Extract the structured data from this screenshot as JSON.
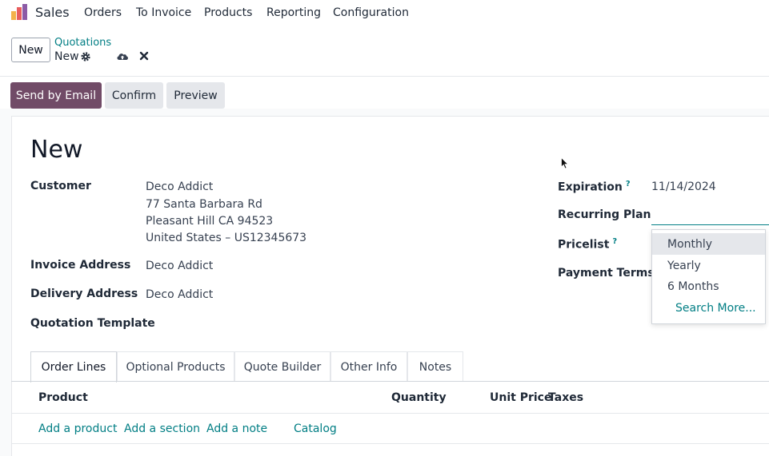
{
  "nav": {
    "app": "Sales",
    "items": [
      "Orders",
      "To Invoice",
      "Products",
      "Reporting",
      "Configuration"
    ]
  },
  "control": {
    "new_label": "New",
    "breadcrumb": "Quotations",
    "record": "New"
  },
  "actions": {
    "send": "Send by Email",
    "confirm": "Confirm",
    "preview": "Preview"
  },
  "form": {
    "title": "New",
    "customer_label": "Customer",
    "customer_lines": [
      "Deco Addict",
      "77 Santa Barbara Rd",
      "Pleasant Hill CA 94523",
      "United States – US12345673"
    ],
    "invoice_label": "Invoice Address",
    "invoice_value": "Deco Addict",
    "delivery_label": "Delivery Address",
    "delivery_value": "Deco Addict",
    "template_label": "Quotation Template",
    "expiration_label": "Expiration",
    "expiration_value": "11/14/2024",
    "recurring_label": "Recurring Plan",
    "pricelist_label": "Pricelist",
    "payment_label": "Payment Terms",
    "help_mark": "?"
  },
  "dropdown": {
    "options": [
      "Monthly",
      "Yearly",
      "6 Months"
    ],
    "more": "Search More..."
  },
  "tabs": [
    "Order Lines",
    "Optional Products",
    "Quote Builder",
    "Other Info",
    "Notes"
  ],
  "lines": {
    "columns": [
      "Product",
      "Quantity",
      "Unit Price",
      "Taxes"
    ],
    "links": [
      "Add a product",
      "Add a section",
      "Add a note",
      "Catalog"
    ]
  },
  "colors": {
    "primary": "#714b67",
    "accent": "#017e84"
  }
}
